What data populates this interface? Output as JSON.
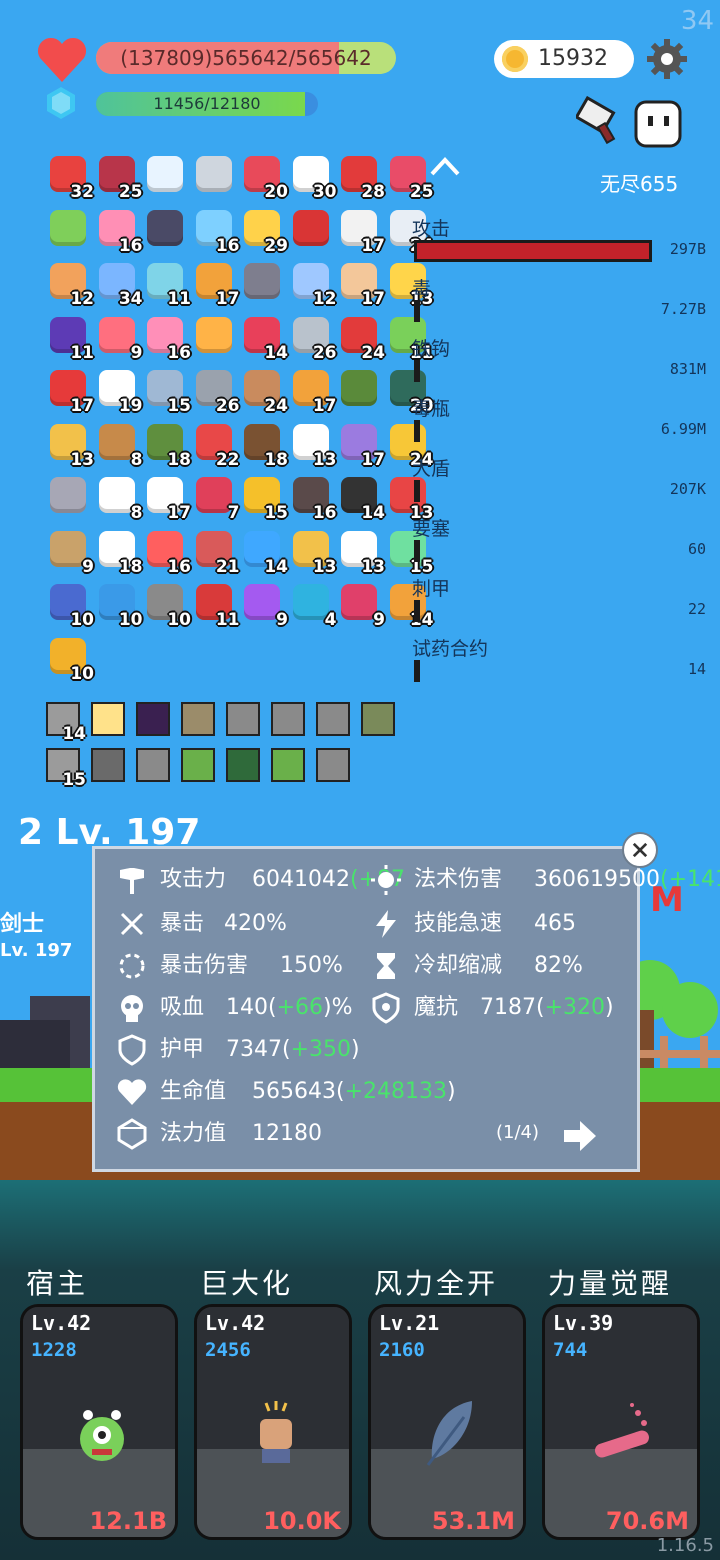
{
  "hud": {
    "fps": "34",
    "hp_text": "(137809)565642/565642",
    "hp_fraction": 1.0,
    "mp_text": "11456/12180",
    "mp_fraction": 0.94,
    "coins": "15932",
    "endless_label": "无尽655"
  },
  "items": [
    {
      "icon": "sock-icon",
      "color": "#e8423f",
      "count": "32"
    },
    {
      "icon": "jam-jar-icon",
      "color": "#b8354a",
      "count": "25"
    },
    {
      "icon": "feather-wing-icon",
      "color": "#e8f4ff",
      "count": ""
    },
    {
      "icon": "sword-icon",
      "color": "#cfd6de",
      "count": ""
    },
    {
      "icon": "watermelon-icon",
      "color": "#e84a5a",
      "count": "20"
    },
    {
      "icon": "flower-icon",
      "color": "#ffffff",
      "count": "30"
    },
    {
      "icon": "apple-icon",
      "color": "#e23b3b",
      "count": "28"
    },
    {
      "icon": "heart-cash-icon",
      "color": "#e94c68",
      "count": "25"
    },
    {
      "icon": "book-green-icon",
      "color": "#7fcf5a",
      "count": ""
    },
    {
      "icon": "ice-cream-icon",
      "color": "#ff8fb5",
      "count": "16"
    },
    {
      "icon": "bat-icon",
      "color": "#4a4a66",
      "count": ""
    },
    {
      "icon": "cat-bubble-icon",
      "color": "#7ed0ff",
      "count": "16"
    },
    {
      "icon": "sun-cloud-icon",
      "color": "#ffd24a",
      "count": "29"
    },
    {
      "icon": "magnet-icon",
      "color": "#d93535",
      "count": ""
    },
    {
      "icon": "clipboard-icon",
      "color": "#f2f2f2",
      "count": "17"
    },
    {
      "icon": "envelope-icon",
      "color": "#e8eef5",
      "count": "24"
    },
    {
      "icon": "milk-carton-icon",
      "color": "#f2a25c",
      "count": "12"
    },
    {
      "icon": "star-frame-icon",
      "color": "#7bb6ff",
      "count": "34"
    },
    {
      "icon": "scroll-icon",
      "color": "#7fd4e8",
      "count": "11"
    },
    {
      "icon": "spell-book-icon",
      "color": "#f2a23b",
      "count": "17"
    },
    {
      "icon": "helmet-icon",
      "color": "#7e7e8e",
      "count": ""
    },
    {
      "icon": "eraser-icon",
      "color": "#9fc8ff",
      "count": "12"
    },
    {
      "icon": "fist-icon",
      "color": "#f3c79a",
      "count": "17"
    },
    {
      "icon": "magic-wand-icon",
      "color": "#ffd54a",
      "count": "13"
    },
    {
      "icon": "hat-box-icon",
      "color": "#5d3bb5",
      "count": "11"
    },
    {
      "icon": "pill-icon",
      "color": "#ff6f7f",
      "count": "9"
    },
    {
      "icon": "spray-bottle-icon",
      "color": "#ff8fb8",
      "count": "16"
    },
    {
      "icon": "card-icon",
      "color": "#ffb347",
      "count": ""
    },
    {
      "icon": "heart-icon",
      "color": "#e8405a",
      "count": "14"
    },
    {
      "icon": "broadsword-icon",
      "color": "#b9c2cc",
      "count": "26"
    },
    {
      "icon": "mushroom-icon",
      "color": "#e23b3b",
      "count": "24"
    },
    {
      "icon": "slime-icon",
      "color": "#7ad05a",
      "count": "11"
    },
    {
      "icon": "red-flag-icon",
      "color": "#e63a3a",
      "count": "17"
    },
    {
      "icon": "lightbulb-icon",
      "color": "#ffffff",
      "count": "19"
    },
    {
      "icon": "shield-icon",
      "color": "#9fb8d4",
      "count": "15"
    },
    {
      "icon": "gear-shield-icon",
      "color": "#9aa2ad",
      "count": "26"
    },
    {
      "icon": "donut-icon",
      "color": "#c98b5e",
      "count": "24"
    },
    {
      "icon": "quest-scroll-icon",
      "color": "#f2a23b",
      "count": "17"
    },
    {
      "icon": "grenade-icon",
      "color": "#5a8a3a",
      "count": ""
    },
    {
      "icon": "target-disc-icon",
      "color": "#2f6b5c",
      "count": "20"
    },
    {
      "icon": "map-icon",
      "color": "#f2c14a",
      "count": "13"
    },
    {
      "icon": "bow-icon",
      "color": "#c78a4a",
      "count": "8"
    },
    {
      "icon": "army-helmet-icon",
      "color": "#5f8f3e",
      "count": "18"
    },
    {
      "icon": "strawberry-icon",
      "color": "#e84848",
      "count": "22"
    },
    {
      "icon": "coconut-icon",
      "color": "#7a5232",
      "count": "18"
    },
    {
      "icon": "cloud-icon",
      "color": "#ffffff",
      "count": "13"
    },
    {
      "icon": "star-shield-icon",
      "color": "#9b7be0",
      "count": "17"
    },
    {
      "icon": "crown-icon",
      "color": "#f7c737",
      "count": "24"
    },
    {
      "icon": "spiked-mace-icon",
      "color": "#a7a7b5",
      "count": ""
    },
    {
      "icon": "ghost-icon",
      "color": "#ffffff",
      "count": "8"
    },
    {
      "icon": "dice-icon",
      "color": "#ffffff",
      "count": "17"
    },
    {
      "icon": "hearts-icon",
      "color": "#e0405a",
      "count": "7"
    },
    {
      "icon": "sunflower-icon",
      "color": "#f5c02a",
      "count": "15"
    },
    {
      "icon": "tombstone-icon",
      "color": "#5a4a4a",
      "count": "16"
    },
    {
      "icon": "cauldron-icon",
      "color": "#333333",
      "count": "14"
    },
    {
      "icon": "gift-box-icon",
      "color": "#e84545",
      "count": "13"
    },
    {
      "icon": "noose-icon",
      "color": "#c9a26a",
      "count": "9"
    },
    {
      "icon": "fried-egg-icon",
      "color": "#ffffff",
      "count": "18"
    },
    {
      "icon": "thermometer-icon",
      "color": "#ff5f5f",
      "count": "16"
    },
    {
      "icon": "steak-icon",
      "color": "#d95a5a",
      "count": "21"
    },
    {
      "icon": "speech-bubble-icon",
      "color": "#3fa8ff",
      "count": "14"
    },
    {
      "icon": "ring-icon",
      "color": "#f2c14a",
      "count": "13"
    },
    {
      "icon": "playing-card-icon",
      "color": "#ffffff",
      "count": "13"
    },
    {
      "icon": "green-blob-icon",
      "color": "#6fe0a0",
      "count": "15"
    },
    {
      "icon": "halo-shoes-icon",
      "color": "#4a6ad0",
      "count": "10"
    },
    {
      "icon": "crosshair-icon",
      "color": "#3a9ae8",
      "count": "10"
    },
    {
      "icon": "compass-icon",
      "color": "#8a8a8a",
      "count": "10"
    },
    {
      "icon": "red-shield-icon",
      "color": "#d93a3a",
      "count": "11"
    },
    {
      "icon": "crystal-ball-icon",
      "color": "#a45af0",
      "count": "9"
    },
    {
      "icon": "sapphire-icon",
      "color": "#2fb3e0",
      "count": "4"
    },
    {
      "icon": "hook-icon",
      "color": "#e0406a",
      "count": "9"
    },
    {
      "icon": "meteor-icon",
      "color": "#f2a23b",
      "count": "14"
    },
    {
      "icon": "coin-stack-icon",
      "color": "#f2b12a",
      "count": "10"
    }
  ],
  "damage_list": [
    {
      "name": "攻击",
      "value": "297B",
      "bar": 1.0
    },
    {
      "name": "毒",
      "value": "7.27B",
      "bar": 0.024
    },
    {
      "name": "铁钩",
      "value": "831M",
      "bar": 0.01
    },
    {
      "name": "毒瓶",
      "value": "6.99M",
      "bar": 0.01
    },
    {
      "name": "大盾",
      "value": "207K",
      "bar": 0.01
    },
    {
      "name": "要塞",
      "value": "60",
      "bar": 0.005
    },
    {
      "name": "刺甲",
      "value": "22",
      "bar": 0.005
    },
    {
      "name": "试药合约",
      "value": "14",
      "bar": 0.005
    }
  ],
  "equip_row1": [
    {
      "color": "#9b9b9b",
      "count": "14"
    },
    {
      "color": "#ffe28a",
      "count": ""
    },
    {
      "color": "#3a2050",
      "count": ""
    },
    {
      "color": "#9b8c6a",
      "count": ""
    },
    {
      "color": "#8a8a8a",
      "count": ""
    },
    {
      "color": "#8a8a8a",
      "count": ""
    },
    {
      "color": "#8a8a8a",
      "count": ""
    },
    {
      "color": "#7a8a5a",
      "count": ""
    }
  ],
  "equip_row2": [
    {
      "color": "#9b9b9b",
      "count": "15"
    },
    {
      "color": "#6a6a6a",
      "count": ""
    },
    {
      "color": "#8a8a8a",
      "count": ""
    },
    {
      "color": "#6ab04a",
      "count": ""
    },
    {
      "color": "#2f6a3a",
      "count": ""
    },
    {
      "color": "#6ab04a",
      "count": ""
    },
    {
      "color": "#8a8a8a",
      "count": ""
    }
  ],
  "battle": {
    "hero_name": "剑士",
    "hero_level": "Lv. 197",
    "big_level": "2 Lv. 197",
    "damage_suffix": "M"
  },
  "stats": {
    "attack": {
      "label": "攻击力",
      "value": "6041042",
      "bonus": "(+87"
    },
    "magic_damage": {
      "label": "法术伤害",
      "value": "360619500",
      "bonus": "(+141"
    },
    "crit": {
      "label": "暴击",
      "value": "420%"
    },
    "skill_haste": {
      "label": "技能急速",
      "value": "465"
    },
    "crit_damage": {
      "label": "暴击伤害",
      "value": "150%"
    },
    "cooldown": {
      "label": "冷却缩减",
      "value": "82%"
    },
    "lifesteal": {
      "label": "吸血",
      "value": "140(",
      "bonus": "+66",
      "suffix": ")%"
    },
    "magic_resist": {
      "label": "魔抗",
      "value": "7187(",
      "bonus": "+320",
      "suffix": ")"
    },
    "armor": {
      "label": "护甲",
      "value": "7347(",
      "bonus": "+350",
      "suffix": ")"
    },
    "hp": {
      "label": "生命值",
      "value": "565643(",
      "bonus": "+248133",
      "suffix": ")"
    },
    "mp": {
      "label": "法力值",
      "value": "12180"
    },
    "page": "(1/4)"
  },
  "skills": [
    {
      "title": "宿主",
      "level": "Lv.42",
      "mp": "1228",
      "cost": "12.1B",
      "icon": "monster-icon"
    },
    {
      "title": "巨大化",
      "level": "Lv.42",
      "mp": "2456",
      "cost": "10.0K",
      "icon": "fist-icon"
    },
    {
      "title": "风力全开",
      "level": "Lv.21",
      "mp": "2160",
      "cost": "53.1M",
      "icon": "feather-icon"
    },
    {
      "title": "力量觉醒",
      "level": "Lv.39",
      "mp": "744",
      "cost": "70.6M",
      "icon": "potion-tube-icon"
    }
  ],
  "version": "1.16.5"
}
